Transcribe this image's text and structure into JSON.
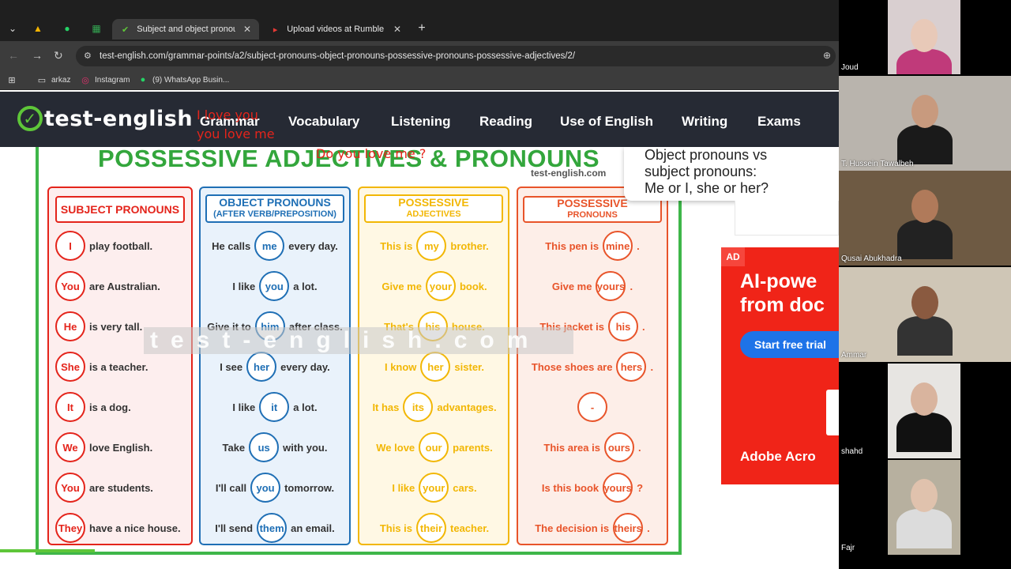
{
  "browser": {
    "tabs": [
      {
        "label": "Subject and object pronouns, p",
        "active": true
      },
      {
        "label": "Upload videos at Rumble",
        "active": false
      }
    ],
    "new_tab": "+",
    "url": "test-english.com/grammar-points/a2/subject-pronouns-object-pronouns-possessive-pronouns-possessive-adjectives/2/",
    "bookmarks": [
      "arkaz",
      "Instagram",
      "(9) WhatsApp Busin..."
    ]
  },
  "site": {
    "logo": "test-english",
    "menu": [
      "Grammar",
      "Vocabulary",
      "Listening",
      "Reading",
      "Use of English",
      "Writing",
      "Exams"
    ],
    "scribbles": [
      "I love you",
      "you love me",
      "Do you love me ?"
    ]
  },
  "popup": {
    "lines": [
      "Object pronouns vs",
      "subject pronouns:",
      "Me or I, she or her?"
    ]
  },
  "ad": {
    "label": "AD",
    "headline": [
      "AI-powe",
      "from doc"
    ],
    "cta": "Start free trial",
    "brand": "Adobe Acro"
  },
  "worksheet": {
    "title": "POSSESSIVE ADJECTIVES & PRONOUNS",
    "source": "test-english.com",
    "watermark": "test-english.com",
    "columns": [
      {
        "heading": [
          "SUBJECT PRONOUNS"
        ],
        "rows": [
          {
            "circle": "I",
            "after": "play football."
          },
          {
            "circle": "You",
            "after": "are Australian."
          },
          {
            "circle": "He",
            "after": "is very tall."
          },
          {
            "circle": "She",
            "after": "is a teacher."
          },
          {
            "circle": "It",
            "after": "is a dog."
          },
          {
            "circle": "We",
            "after": "love English."
          },
          {
            "circle": "You",
            "after": "are students."
          },
          {
            "circle": "They",
            "after": "have a nice house."
          }
        ]
      },
      {
        "heading": [
          "OBJECT PRONOUNS",
          "(AFTER VERB/PREPOSITION)"
        ],
        "rows": [
          {
            "before": "He calls",
            "circle": "me",
            "after": "every day."
          },
          {
            "before": "I like",
            "circle": "you",
            "after": "a lot."
          },
          {
            "before": "Give it to",
            "circle": "him",
            "after": "after class."
          },
          {
            "before": "I see",
            "circle": "her",
            "after": "every day."
          },
          {
            "before": "I like",
            "circle": "it",
            "after": "a lot."
          },
          {
            "before": "Take",
            "circle": "us",
            "after": "with you."
          },
          {
            "before": "I'll call",
            "circle": "you",
            "after": "tomorrow."
          },
          {
            "before": "I'll send",
            "circle": "them",
            "after": "an email."
          }
        ]
      },
      {
        "heading": [
          "POSSESSIVE",
          "ADJECTIVES"
        ],
        "rows": [
          {
            "before": "This is",
            "circle": "my",
            "after": "brother."
          },
          {
            "before": "Give me",
            "circle": "your",
            "after": "book."
          },
          {
            "before": "That's",
            "circle": "his",
            "after": "house."
          },
          {
            "before": "I know",
            "circle": "her",
            "after": "sister."
          },
          {
            "before": "It has",
            "circle": "its",
            "after": "advantages."
          },
          {
            "before": "We love",
            "circle": "our",
            "after": "parents."
          },
          {
            "before": "I like",
            "circle": "your",
            "after": "cars."
          },
          {
            "before": "This is",
            "circle": "their",
            "after": "teacher."
          }
        ]
      },
      {
        "heading": [
          "POSSESSIVE",
          "PRONOUNS"
        ],
        "rows": [
          {
            "before": "This pen is",
            "circle": "mine",
            "after": "."
          },
          {
            "before": "Give me",
            "circle": "yours",
            "after": "."
          },
          {
            "before": "This jacket is",
            "circle": "his",
            "after": "."
          },
          {
            "before": "Those shoes are",
            "circle": "hers",
            "after": "."
          },
          {
            "before": "",
            "circle": "-",
            "after": ""
          },
          {
            "before": "This area is",
            "circle": "ours",
            "after": "."
          },
          {
            "before": "Is this book",
            "circle": "yours",
            "after": "?"
          },
          {
            "before": "The decision is",
            "circle": "theirs",
            "after": "."
          }
        ]
      }
    ]
  },
  "participants": [
    {
      "name": "Joud"
    },
    {
      "name": "T. Hussein Tawalbeh"
    },
    {
      "name": "Qusai Abukhadra"
    },
    {
      "name": "Ammar"
    },
    {
      "name": "shahd"
    },
    {
      "name": "Fajr"
    }
  ],
  "colors": {
    "green": "#3eb649",
    "red": "#e4241b",
    "blue": "#1f6fb5",
    "yellow": "#f2b705",
    "orange": "#e8542a"
  }
}
